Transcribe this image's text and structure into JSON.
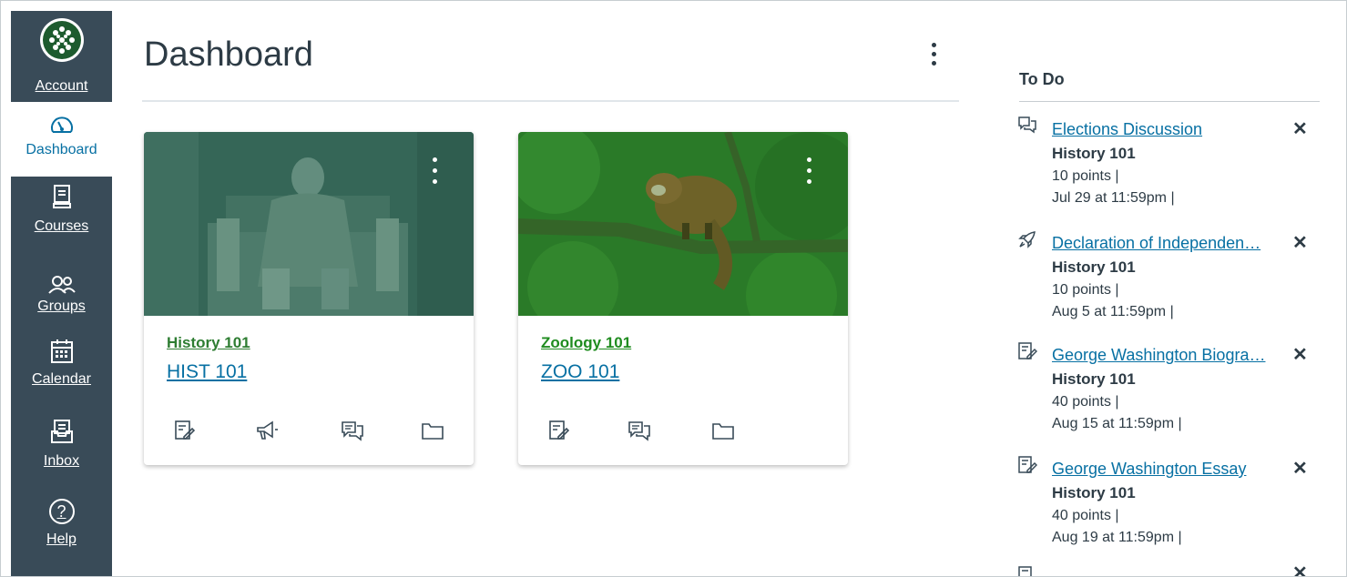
{
  "nav": {
    "account": "Account",
    "dashboard": "Dashboard",
    "courses": "Courses",
    "groups": "Groups",
    "calendar": "Calendar",
    "inbox": "Inbox",
    "help": "Help",
    "help_glyph": "?"
  },
  "page": {
    "title": "Dashboard"
  },
  "cards": [
    {
      "subtitle": "History 101",
      "code": "HIST 101",
      "subtitle_color": "#2e7d32",
      "actions": [
        "assignments-icon",
        "announcements-icon",
        "discussions-icon",
        "files-icon"
      ]
    },
    {
      "subtitle": "Zoology 101",
      "code": "ZOO 101",
      "subtitle_color": "#1f8c1f",
      "actions": [
        "assignments-icon",
        "discussions-icon",
        "files-icon"
      ]
    }
  ],
  "todo": {
    "title": "To Do",
    "dismiss_glyph": "✕",
    "items": [
      {
        "icon": "discussion-icon",
        "title": "Elections Discussion",
        "course": "History 101",
        "points": "10 points  |",
        "due": "Jul 29 at 11:59pm  |"
      },
      {
        "icon": "quiz-icon",
        "title": "Declaration of Independen…",
        "course": "History 101",
        "points": "10 points  |",
        "due": "Aug 5 at 11:59pm  |"
      },
      {
        "icon": "assignment-icon",
        "title": "George Washington Biogra…",
        "course": "History 101",
        "points": "40 points  |",
        "due": "Aug 15 at 11:59pm  |"
      },
      {
        "icon": "assignment-icon",
        "title": "George Washington Essay",
        "course": "History 101",
        "points": "40 points  |",
        "due": "Aug 19 at 11:59pm  |"
      }
    ]
  }
}
